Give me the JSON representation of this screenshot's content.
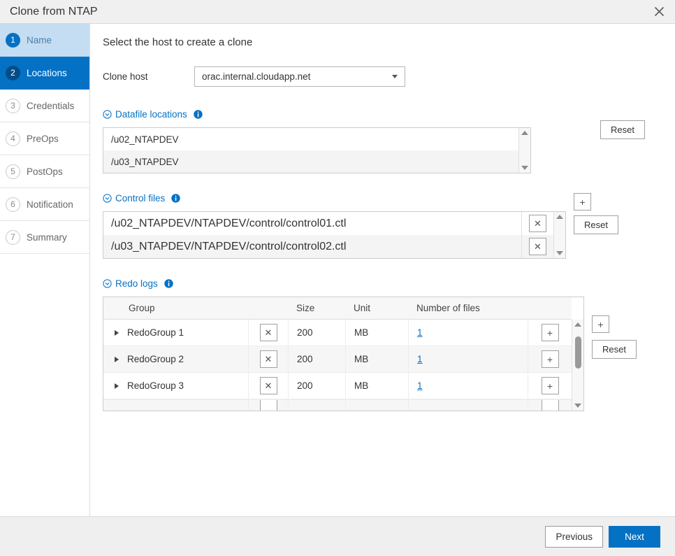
{
  "window": {
    "title": "Clone from NTAP",
    "close_icon": "close-icon"
  },
  "sidebar": {
    "steps": [
      {
        "num": "1",
        "label": "Name",
        "state": "visited"
      },
      {
        "num": "2",
        "label": "Locations",
        "state": "active"
      },
      {
        "num": "3",
        "label": "Credentials",
        "state": "idle"
      },
      {
        "num": "4",
        "label": "PreOps",
        "state": "idle"
      },
      {
        "num": "5",
        "label": "PostOps",
        "state": "idle"
      },
      {
        "num": "6",
        "label": "Notification",
        "state": "idle"
      },
      {
        "num": "7",
        "label": "Summary",
        "state": "idle"
      }
    ]
  },
  "main": {
    "heading": "Select the host to create a clone",
    "clone_host": {
      "label": "Clone host",
      "value": "orac.internal.cloudapp.net",
      "caret_icon": "chevron-down-icon"
    },
    "datafile_locations": {
      "title": "Datafile locations",
      "collapse_icon": "circle-chevron-down-icon",
      "info_icon": "info-icon",
      "reset_label": "Reset",
      "items": [
        "/u02_NTAPDEV",
        "/u03_NTAPDEV"
      ]
    },
    "control_files": {
      "title": "Control files",
      "collapse_icon": "circle-chevron-down-icon",
      "info_icon": "info-icon",
      "add_label": "+",
      "reset_label": "Reset",
      "remove_label": "✕",
      "items": [
        "/u02_NTAPDEV/NTAPDEV/control/control01.ctl",
        "/u03_NTAPDEV/NTAPDEV/control/control02.ctl"
      ]
    },
    "redo_logs": {
      "title": "Redo logs",
      "collapse_icon": "circle-chevron-down-icon",
      "info_icon": "info-icon",
      "add_label": "+",
      "reset_label": "Reset",
      "remove_label": "✕",
      "row_add_label": "+",
      "columns": [
        "Group",
        "Size",
        "Unit",
        "Number of files"
      ],
      "rows": [
        {
          "group": "RedoGroup 1",
          "size": "200",
          "unit": "MB",
          "files": "1"
        },
        {
          "group": "RedoGroup 2",
          "size": "200",
          "unit": "MB",
          "files": "1"
        },
        {
          "group": "RedoGroup 3",
          "size": "200",
          "unit": "MB",
          "files": "1"
        }
      ]
    }
  },
  "footer": {
    "previous_label": "Previous",
    "next_label": "Next"
  },
  "colors": {
    "accent": "#0571c4",
    "accent_dark": "#024d87",
    "visited_bg": "#c5ddf2",
    "titlebar_bg": "#f0f0f0",
    "footer_bg": "#efefef"
  }
}
